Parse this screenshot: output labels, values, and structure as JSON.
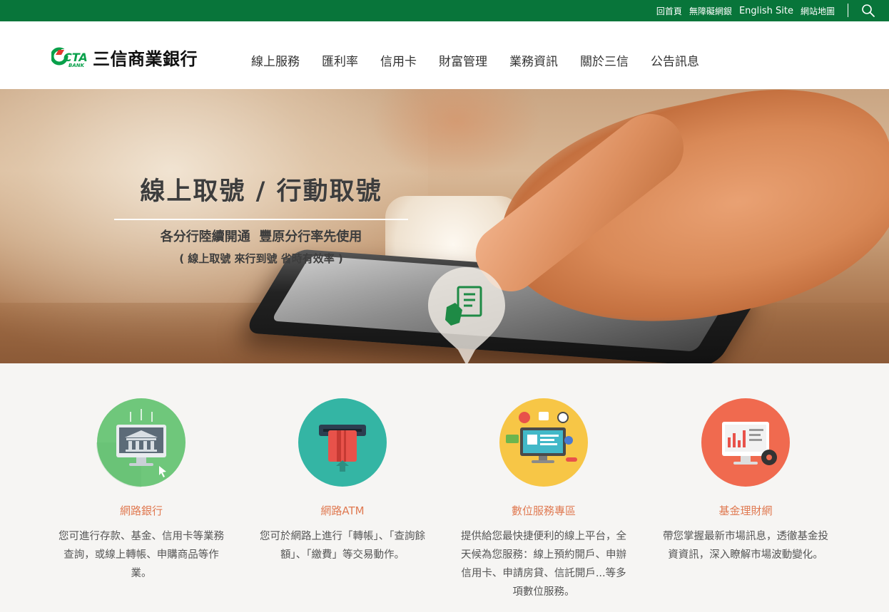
{
  "topbar": {
    "links": [
      "回首頁",
      "無障礙網銀",
      "English Site",
      "網站地圖"
    ]
  },
  "header": {
    "logo_mark": "CTA",
    "logo_sub": "BANK",
    "logo_text": "三信商業銀行",
    "nav": [
      "線上服務",
      "匯利率",
      "信用卡",
      "財富管理",
      "業務資訊",
      "關於三信",
      "公告訊息"
    ]
  },
  "hero": {
    "title": "線上取號 / 行動取號",
    "subtitle": "各分行陸續開通  豐原分行率先使用",
    "note": "( 線上取號 來行到號 省時有效率 )"
  },
  "services": [
    {
      "icon": "online-banking-icon",
      "color": "#6fc77b",
      "title": "網路銀行",
      "desc": "您可進行存款、基金、信用卡等業務查詢，或線上轉帳、申購商品等作業。"
    },
    {
      "icon": "atm-card-icon",
      "color": "#34b5a4",
      "title": "網路ATM",
      "desc": "您可於網路上進行「轉帳」、「查詢餘額」、「繳費」等交易動作。"
    },
    {
      "icon": "digital-service-icon",
      "color": "#f7c646",
      "title": "數位服務專區",
      "desc": "提供給您最快捷便利的線上平台，全天候為您服務：線上預約開戶、申辦信用卡、申請房貸、信託開戶...等多項數位服務。"
    },
    {
      "icon": "fund-chart-icon",
      "color": "#f06a4f",
      "title": "基金理財網",
      "desc": "帶您掌握最新市場訊息，透徹基金投資資訊，深入瞭解市場波動變化。"
    }
  ],
  "colors": {
    "brand_green": "#08753a",
    "accent_orange": "#e07a52"
  }
}
